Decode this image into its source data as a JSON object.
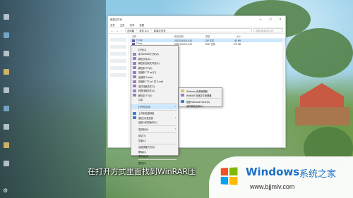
{
  "explorer": {
    "title": "新建文件夹",
    "ribbon": [
      "文件",
      "主页",
      "共享",
      "查看"
    ],
    "address": [
      "此电脑",
      "软件 (D:)",
      "新建文件夹"
    ],
    "search_placeholder": "搜索\"新建文件夹\"",
    "columns": [
      "名称",
      "修改日期",
      "类型",
      "大小"
    ],
    "files": [
      {
        "name": "TT.zip",
        "date": "2022/10/15 14:24",
        "type": "ZIP 文件",
        "size": "60 KB",
        "selected": true
      },
      {
        "name": "TT.rar",
        "date": "2022/10/15 14:25",
        "type": "RAR 文件",
        "size": "275 KB",
        "selected": false
      }
    ]
  },
  "context_menu": {
    "items": [
      {
        "label": "打开(O)",
        "icon": "blank"
      },
      {
        "label": "用 WinRAR 打开(W)",
        "icon": "winrar"
      },
      {
        "label": "解压文件(A)...",
        "icon": "winrar"
      },
      {
        "label": "解压到当前文件夹(X)",
        "icon": "winrar"
      },
      {
        "label": "解压到 TT\\(E)",
        "icon": "winrar"
      },
      {
        "label": "压缩到 \"TT.rar\"(T)",
        "icon": "winrar"
      },
      {
        "label": "压缩并 E-mail...",
        "icon": "winrar"
      },
      {
        "label": "压缩到 \"TT.rar\" 并 E-mail",
        "icon": "winrar"
      },
      {
        "label": "测试压缩文件(T)",
        "icon": "winrar"
      },
      {
        "label": "转换压缩文件(V)",
        "icon": "winrar"
      },
      {
        "label": "解压到 TT\\(E)",
        "icon": "winrar"
      },
      {
        "label": "共享",
        "icon": "blank"
      },
      {
        "label": "打开方式(H)",
        "icon": "blank",
        "submenu": true,
        "highlighted": true
      },
      {
        "label": "上传到百度网盘",
        "icon": "blue"
      },
      {
        "label": "通过QQ发送到",
        "icon": "blue",
        "submenu": true
      },
      {
        "label": "还原以前的版本(V)",
        "icon": "blank"
      },
      {
        "label": "发送到(N)",
        "icon": "blank",
        "submenu": true
      },
      {
        "label": "剪切(T)",
        "icon": "blank"
      },
      {
        "label": "复制(C)",
        "icon": "blank"
      },
      {
        "label": "创建快捷方式(S)",
        "icon": "blank"
      },
      {
        "label": "删除(D)",
        "icon": "blank"
      },
      {
        "label": "重命名(M)",
        "icon": "blank"
      },
      {
        "label": "属性(R)",
        "icon": "blank"
      }
    ]
  },
  "open_with_menu": {
    "items": [
      {
        "label": "Windows 资源管理器",
        "icon": "folder"
      },
      {
        "label": "WinRAR 压缩文件管理器",
        "icon": "winrar"
      },
      {
        "label": "搜索 Microsoft Store(S)",
        "icon": "blue"
      },
      {
        "label": "选择其他应用(C)",
        "icon": "blank"
      }
    ]
  },
  "subtitle": "在打开方式里面找到WinRAR压",
  "watermark": {
    "title": "Windows",
    "cn": "系统之家",
    "url": "www.bjjmlv.com",
    "logo_colors": [
      "#f25022",
      "#7fba00",
      "#00a4ef",
      "#ffb900"
    ]
  }
}
